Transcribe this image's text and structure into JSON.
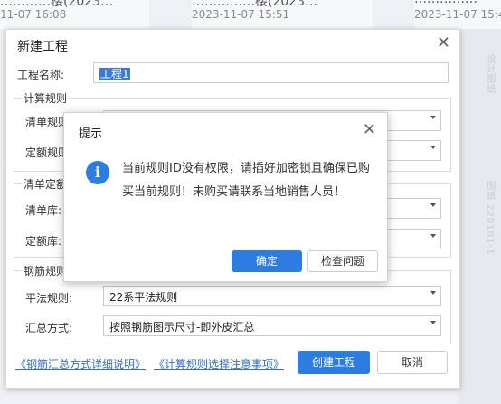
{
  "background": {
    "cards": [
      {
        "title": "…………楼(2023…",
        "date": "11-07 16:08"
      },
      {
        "title": "……………楼(2023…",
        "date": "2023-11-07 15:51"
      },
      {
        "title": "……………",
        "date": "2023-11-07 15:48"
      }
    ],
    "side_text_1": "设计图纸",
    "side_text_2": "图纸 220101-1"
  },
  "dialog": {
    "title": "新建工程",
    "project_name_label": "工程名称:",
    "project_name_value": "工程1",
    "calc_rules_group": "计算规则",
    "list_rule_label": "清单规则:",
    "quota_rule_label": "定额规则:",
    "list_quota_group": "清单定额库",
    "list_lib_label": "清单库:",
    "quota_lib_label": "定额库:",
    "rebar_group": "钢筋规则",
    "flat_rule_label": "平法规则:",
    "flat_rule_value": "22系平法规则",
    "summary_label": "汇总方式:",
    "summary_value": "按照钢筋图示尺寸-即外皮汇总",
    "link_summary": "《钢筋汇总方式详细说明》",
    "link_calc": "《计算规则选择注意事项》",
    "create_button": "创建工程",
    "cancel_button": "取消"
  },
  "modal": {
    "title": "提示",
    "message": "当前规则ID没有权限，请插好加密锁且确保已购买当前规则！未购买请联系当地销售人员！",
    "confirm_button": "确定",
    "check_button": "检查问题"
  },
  "colors": {
    "primary": "#2d7de0",
    "link": "#2f6fd1",
    "highlight": "#3b7bd7"
  },
  "icons": {
    "close": "close-icon",
    "info": "info-icon",
    "dropdown": "chevron-down-icon"
  }
}
